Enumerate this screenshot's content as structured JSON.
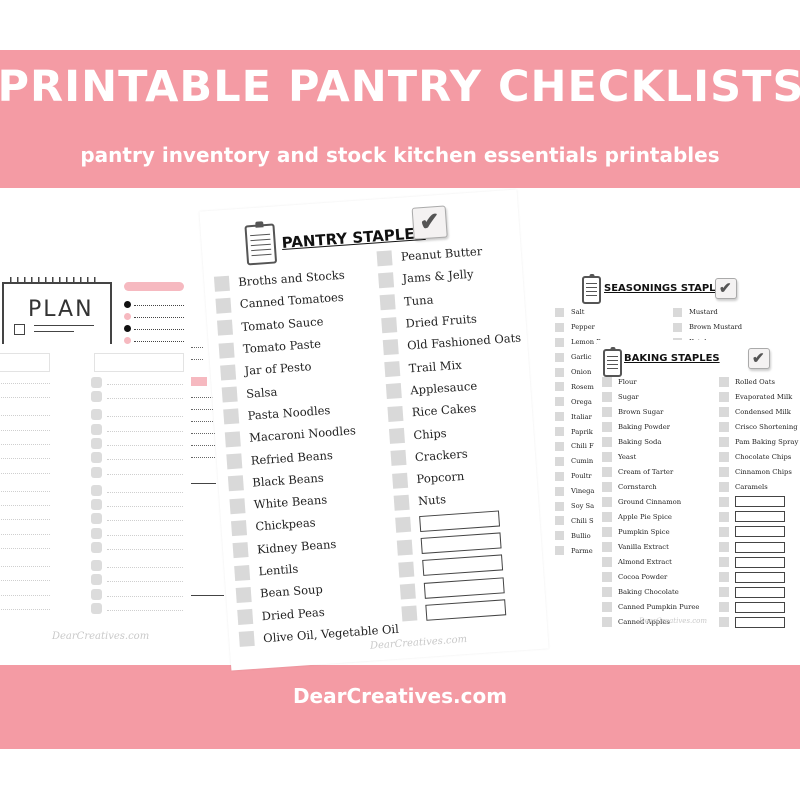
{
  "header": {
    "title": "PRINTABLE PANTRY CHECKLISTS",
    "subtitle": "pantry inventory and stock kitchen essentials printables"
  },
  "footer": {
    "site": "DearCreatives.com"
  },
  "colors": {
    "banner_pink": "#f49ba4",
    "accent_pink_light": "#f6b9c0",
    "checkbox_gray": "#d9d9d9",
    "text_dark": "#222222"
  },
  "planner_sheet": {
    "heading": "PLAN",
    "watermark": "DearCreatives.com"
  },
  "pantry_sheet": {
    "title": "PANTRY STAPLES",
    "icons": [
      "clipboard-icon",
      "checkmark-icon"
    ],
    "left_items": [
      "Broths and Stocks",
      "Canned Tomatoes",
      "Tomato Sauce",
      "Tomato Paste",
      "Jar of Pesto",
      "Salsa",
      "Pasta Noodles",
      "Macaroni Noodles",
      "Refried Beans",
      "Black Beans",
      "White Beans",
      "Chickpeas",
      "Kidney Beans",
      "Lentils",
      "Bean Soup",
      "Dried Peas",
      "Olive Oil, Vegetable Oil"
    ],
    "right_items": [
      "Peanut Butter",
      "Jams & Jelly",
      "Tuna",
      "Dried Fruits",
      "Old Fashioned Oats",
      "Trail Mix",
      "Applesauce",
      "Rice Cakes",
      "Chips",
      "Crackers",
      "Popcorn",
      "Nuts"
    ],
    "blank_lines": 5,
    "watermark": "DearCreatives.com"
  },
  "seasonings_sheet": {
    "title": "SEASONINGS STAPLES",
    "left_items": [
      "Salt",
      "Pepper",
      "Lemon Pepper",
      "Garlic",
      "Onion",
      "Rosem",
      "Orega",
      "Italiar",
      "Paprik",
      "Chili F",
      "Cumin",
      "Poultr",
      "Vinega",
      "Soy Sa",
      "Chili S",
      "Bullio",
      "Parme"
    ],
    "right_items": [
      "Mustard",
      "Brown Mustard",
      "Ketchup"
    ]
  },
  "baking_sheet": {
    "title": "BAKING STAPLES",
    "left_items": [
      "Flour",
      "Sugar",
      "Brown Sugar",
      "Baking Powder",
      "Baking Soda",
      "Yeast",
      "Cream of Tarter",
      "Cornstarch",
      "Ground Cinnamon",
      "Apple Pie Spice",
      "Pumpkin Spice",
      "Vanilla Extract",
      "Almond Extract",
      "Cocoa Powder",
      "Baking Chocolate",
      "Canned Pumpkin Puree",
      "Canned Apples"
    ],
    "right_items": [
      "Rolled Oats",
      "Evaporated Milk",
      "Condensed Milk",
      "Crisco Shortening",
      "Pam Baking Spray",
      "Chocolate Chips",
      "Cinnamon Chips",
      "Caramels"
    ],
    "blank_lines": 9,
    "watermark": "DearCreatives.com"
  }
}
